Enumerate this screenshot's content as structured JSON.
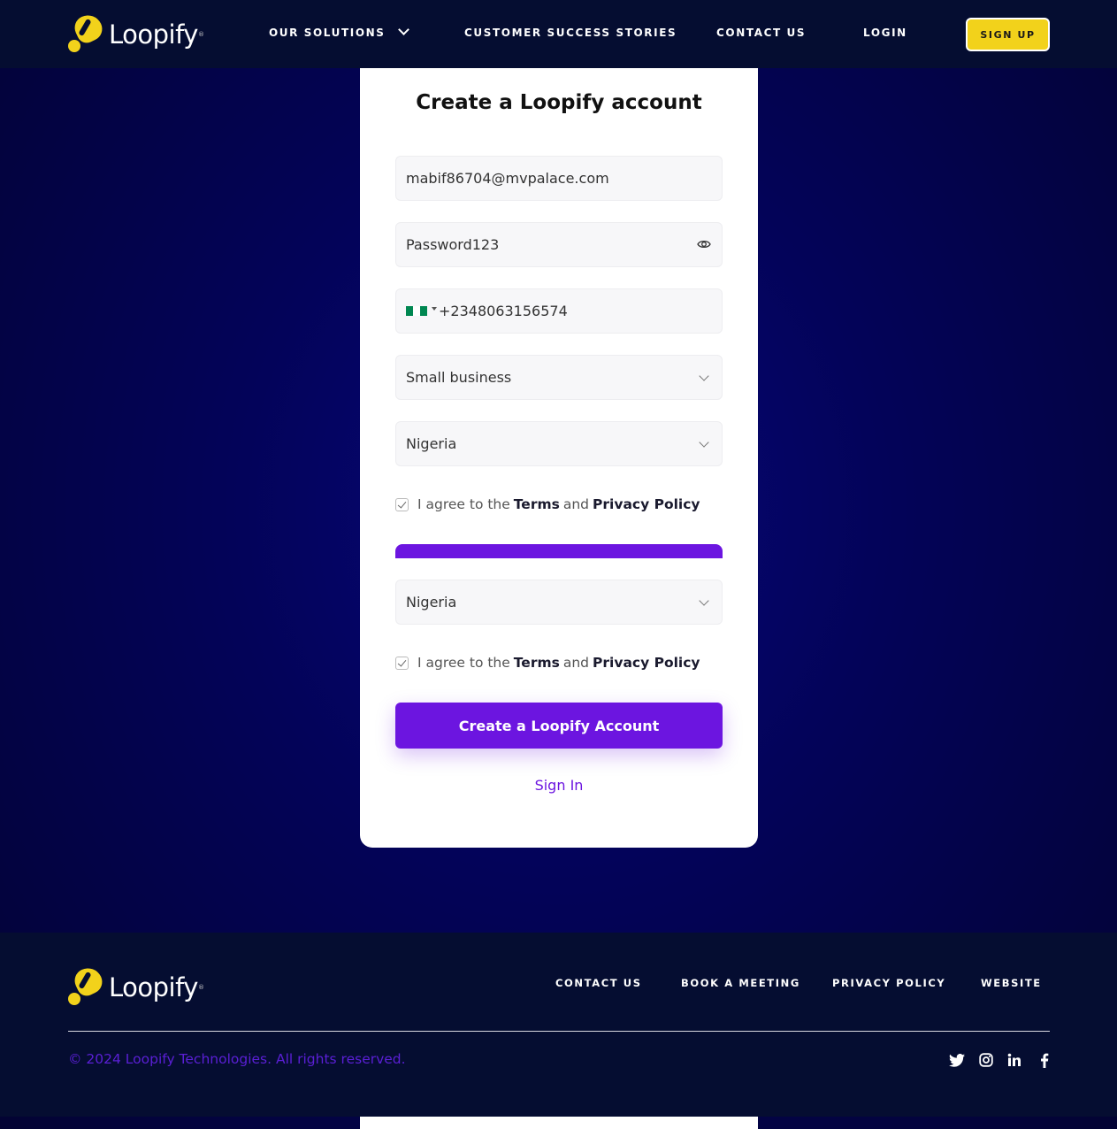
{
  "header": {
    "brand": "Loopify",
    "nav": {
      "solutions": "OUR SOLUTIONS",
      "stories": "CUSTOMER SUCCESS STORIES",
      "contact": "CONTACT US",
      "login": "LOGIN"
    },
    "signup": "SIGN UP"
  },
  "form": {
    "title": "Create a Loopify account",
    "email": "mabif86704@mvpalace.com",
    "password": "Password123",
    "phone": "+2348063156574",
    "business_type": "Small business",
    "country": "Nigeria",
    "country_dup": "Nigeria",
    "agree": {
      "prefix": "I agree to the",
      "terms": "Terms",
      "and": "and",
      "privacy": "Privacy Policy"
    },
    "submit": "Create a Loopify Account",
    "signin": "Sign In"
  },
  "footer": {
    "brand": "Loopify",
    "nav": {
      "contact": "CONTACT US",
      "book": "BOOK A MEETING",
      "privacy": "PRIVACY POLICY",
      "website": "WEBSITE"
    },
    "copyright": "© 2024 Loopify Technologies. All rights reserved.",
    "social": [
      "twitter-icon",
      "instagram-icon",
      "linkedin-icon",
      "facebook-icon"
    ]
  },
  "colors": {
    "accent": "#6c15e0",
    "brand_yellow": "#f2d21b",
    "header_bg": "#050d31",
    "page_bg": "#03035a"
  }
}
